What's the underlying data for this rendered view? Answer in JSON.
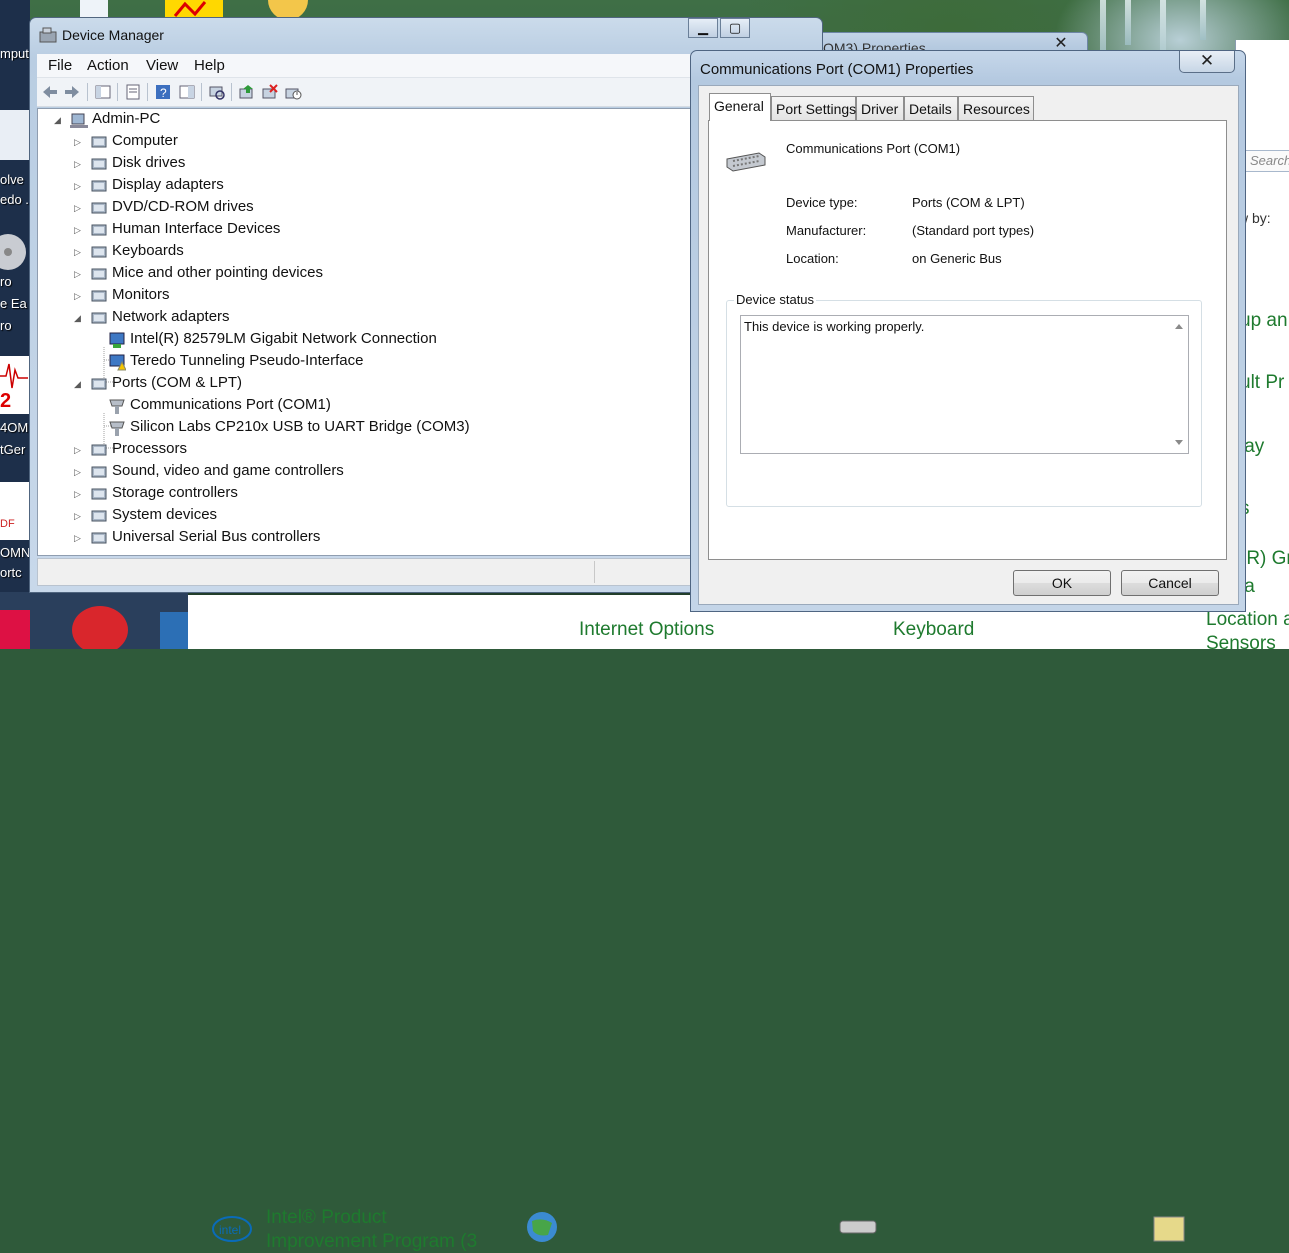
{
  "device_manager": {
    "title": "Device Manager",
    "menu": [
      "File",
      "Action",
      "View",
      "Help"
    ],
    "computer_name": "Admin-PC",
    "categories": [
      "Computer",
      "Disk drives",
      "Display adapters",
      "DVD/CD-ROM drives",
      "Human Interface Devices",
      "Keyboards",
      "Mice and other pointing devices",
      "Monitors",
      "Network adapters",
      "Ports (COM & LPT)",
      "Processors",
      "Sound, video and game controllers",
      "Storage controllers",
      "System devices",
      "Universal Serial Bus controllers"
    ],
    "network_children": [
      "Intel(R) 82579LM Gigabit Network Connection",
      "Teredo Tunneling Pseudo-Interface"
    ],
    "ports_children": [
      "Communications Port (COM1)",
      "Silicon Labs CP210x USB to UART Bridge (COM3)"
    ]
  },
  "background_dialog": {
    "title_fragment": "OM3) Properties"
  },
  "properties_dialog": {
    "title": "Communications Port (COM1) Properties",
    "close": "✕",
    "tabs": [
      "General",
      "Port Settings",
      "Driver",
      "Details",
      "Resources"
    ],
    "device_name": "Communications Port (COM1)",
    "device_type_label": "Device type:",
    "device_type_value": "Ports (COM & LPT)",
    "manufacturer_label": "Manufacturer:",
    "manufacturer_value": "(Standard port types)",
    "location_label": "Location:",
    "location_value": "on Generic Bus",
    "status_group_label": "Device status",
    "status_text": "This device is working properly.",
    "ok_label": "OK",
    "cancel_label": "Cancel"
  },
  "control_panel": {
    "search_placeholder": "Search",
    "view_by_fragment": "w by:",
    "right_fragments": [
      "up an",
      "ult Pr",
      "lay",
      "s",
      "(R) Gr",
      "ia"
    ],
    "bottom_items": [
      {
        "line1": "Intel® Product",
        "line2": "Improvement Program (3"
      },
      {
        "line1": "Internet Options"
      },
      {
        "line1": "Keyboard"
      },
      {
        "line1": "Location a",
        "line2": "Sensors"
      }
    ]
  },
  "desktop": {
    "labels": [
      "mpute",
      "olve",
      "edo .",
      "ro",
      "e Ea",
      "ro",
      "2",
      "4OM",
      "tGer",
      "DF",
      "OMN",
      "ortc"
    ]
  }
}
